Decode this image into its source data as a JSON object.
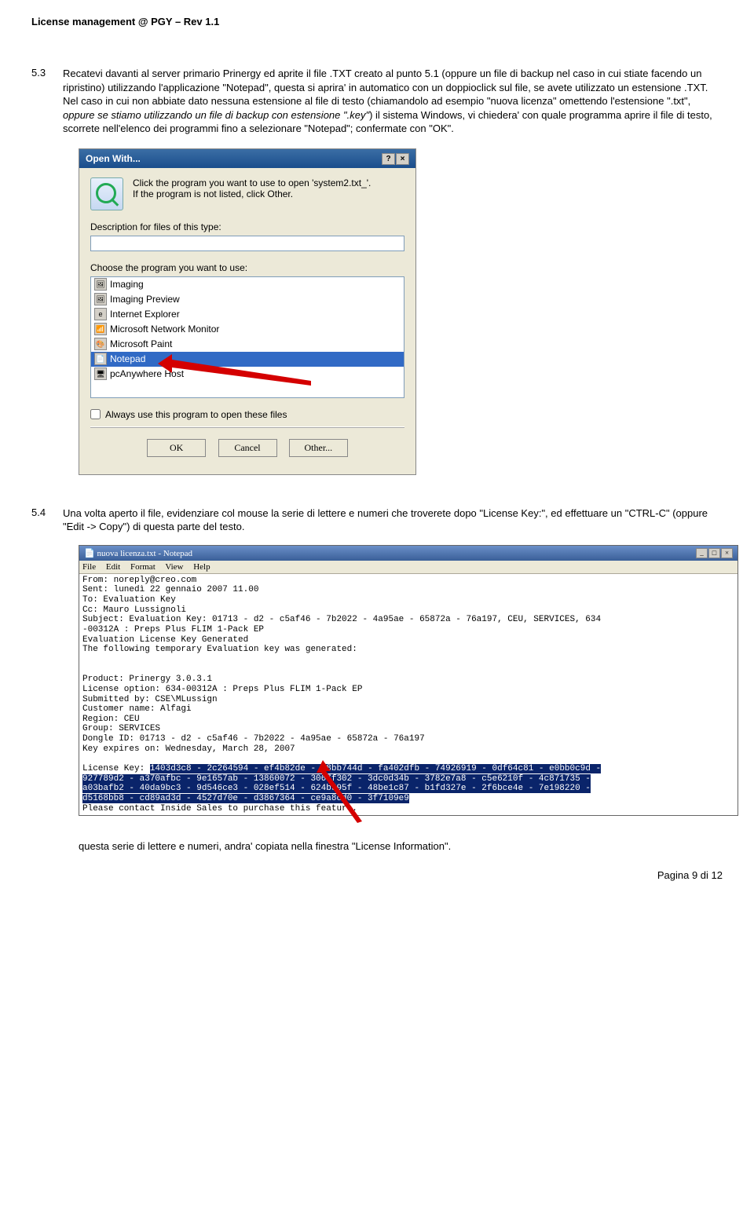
{
  "header": "License management @ PGY – Rev 1.1",
  "s53": {
    "num": "5.3",
    "text_a": "Recatevi davanti al server primario Prinergy ed aprite il file .TXT creato al punto 5.1 (oppure un file di backup nel caso in cui stiate facendo un ripristino) utilizzando l'applicazione \"Notepad\", questa si aprira' in automatico con un doppioclick sul file, se avete utilizzato un estensione .TXT. Nel caso in cui non abbiate dato nessuna estensione al file di testo (chiamandolo ad esempio \"nuova licenza\" omettendo l'estensione \".txt\", ",
    "text_i": "oppure se stiamo utilizzando un file di backup con estensione \".key\"",
    "text_b": ") il sistema Windows, vi chiedera' con quale programma aprire il file di testo, scorrete nell'elenco dei programmi fino a selezionare \"Notepad\"; confermate con \"OK\"."
  },
  "dialog": {
    "title": "Open With...",
    "prompt1": "Click the program you want to use to open 'system2.txt_'.",
    "prompt2": "If the program is not listed, click Other.",
    "desc_label": "Description for files of this type:",
    "choose_label": "Choose the program you want to use:",
    "items": [
      "Imaging",
      "Imaging Preview",
      "Internet Explorer",
      "Microsoft Network Monitor",
      "Microsoft Paint",
      "Notepad",
      "pcAnywhere Host"
    ],
    "selected": "Notepad",
    "always": "Always use this program to open these files",
    "ok": "OK",
    "cancel": "Cancel",
    "other": "Other..."
  },
  "s54": {
    "num": "5.4",
    "text": "Una volta aperto il file, evidenziare col mouse la serie di lettere e numeri che troverete dopo \"License Key:\", ed effettuare un \"CTRL-C\" (oppure \"Edit -> Copy\") di questa parte del testo."
  },
  "notepad": {
    "title": "nuova licenza.txt - Notepad",
    "menu": [
      "File",
      "Edit",
      "Format",
      "View",
      "Help"
    ],
    "lines_pre": [
      "From: noreply@creo.com",
      "Sent: lunedì 22 gennaio 2007 11.00",
      "To: Evaluation Key",
      "Cc: Mauro Lussignoli",
      "Subject: Evaluation Key: 01713 - d2 - c5af46 - 7b2022 - 4a95ae - 65872a - 76a197, CEU, SERVICES, 634",
      "-00312A : Preps Plus FLIM 1-Pack EP",
      "Evaluation License Key Generated",
      "The following temporary Evaluation key was generated:",
      "",
      "",
      "Product: Prinergy 3.0.3.1",
      "License option: 634-00312A : Preps Plus FLIM 1-Pack EP",
      "Submitted by: CSE\\MLussign",
      "Customer name: Alfagi",
      "Region: CEU",
      "Group: SERVICES",
      "Dongle ID: 01713 - d2 - c5af46 - 7b2022 - 4a95ae - 65872a - 76a197",
      "Key expires on: Wednesday, March 28, 2007",
      ""
    ],
    "key_label": "License Key: ",
    "key_lines": [
      "1403d3c8 - 2c264594 - ef4b82de - b8bb744d - fa402dfb - 74926919 - 0df64c81 - e0bb0c9d -",
      "927789d2 - a370afbc - 9e1657ab - 13860072 - 3067f302 - 3dc0d34b - 3782e7a8 - c5e6210f - 4c871735 -",
      "a03bafb2 - 40da9bc3 - 9d546ce3 - 028ef514 - 624b595f - 48be1c87 - b1fd327e - 2f6bce4e - 7e198220 -",
      "d5168bb8 - cd89ad3d - 4527d70e - d3867364 - ce9a8cd0 - 3f7109e9"
    ],
    "last_line": "Please contact Inside Sales to purchase this feature."
  },
  "footer_text": "questa serie di lettere e numeri, andra' copiata nella finestra \"License Information\".",
  "page": "Pagina 9 di 12"
}
